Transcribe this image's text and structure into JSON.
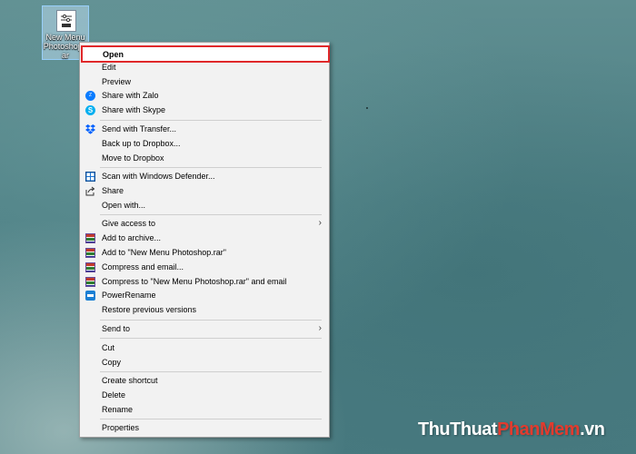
{
  "desktop": {
    "icon_label": "New Menu Photoshop.rar"
  },
  "watermark": {
    "part1": "ThuThuat",
    "part2": "PhanMem",
    "part3": ".vn"
  },
  "menu": {
    "items": [
      {
        "label": "Open",
        "icon": "none",
        "highlighted": true
      },
      {
        "label": "Edit",
        "icon": "none"
      },
      {
        "label": "Preview",
        "icon": "none"
      },
      {
        "label": "Share with Zalo",
        "icon": "zalo-icon"
      },
      {
        "label": "Share with Skype",
        "icon": "skype-icon"
      },
      {
        "label": "Send with Transfer...",
        "icon": "dropbox-icon"
      },
      {
        "label": "Back up to Dropbox...",
        "icon": "none"
      },
      {
        "label": "Move to Dropbox",
        "icon": "none"
      },
      {
        "label": "Scan with Windows Defender...",
        "icon": "defender-icon"
      },
      {
        "label": "Share",
        "icon": "share-icon"
      },
      {
        "label": "Open with...",
        "icon": "none"
      },
      {
        "label": "Give access to",
        "icon": "none",
        "submenu": true
      },
      {
        "label": "Add to archive...",
        "icon": "winrar-icon"
      },
      {
        "label": "Add to \"New Menu Photoshop.rar\"",
        "icon": "winrar-icon"
      },
      {
        "label": "Compress and email...",
        "icon": "winrar-icon"
      },
      {
        "label": "Compress to \"New Menu Photoshop.rar\" and email",
        "icon": "winrar-icon"
      },
      {
        "label": "PowerRename",
        "icon": "powerrename-icon"
      },
      {
        "label": "Restore previous versions",
        "icon": "none"
      },
      {
        "label": "Send to",
        "icon": "none",
        "submenu": true
      },
      {
        "label": "Cut",
        "icon": "none"
      },
      {
        "label": "Copy",
        "icon": "none"
      },
      {
        "label": "Create shortcut",
        "icon": "none"
      },
      {
        "label": "Delete",
        "icon": "none"
      },
      {
        "label": "Rename",
        "icon": "none"
      },
      {
        "label": "Properties",
        "icon": "none"
      }
    ],
    "submenu_glyph": "›"
  }
}
